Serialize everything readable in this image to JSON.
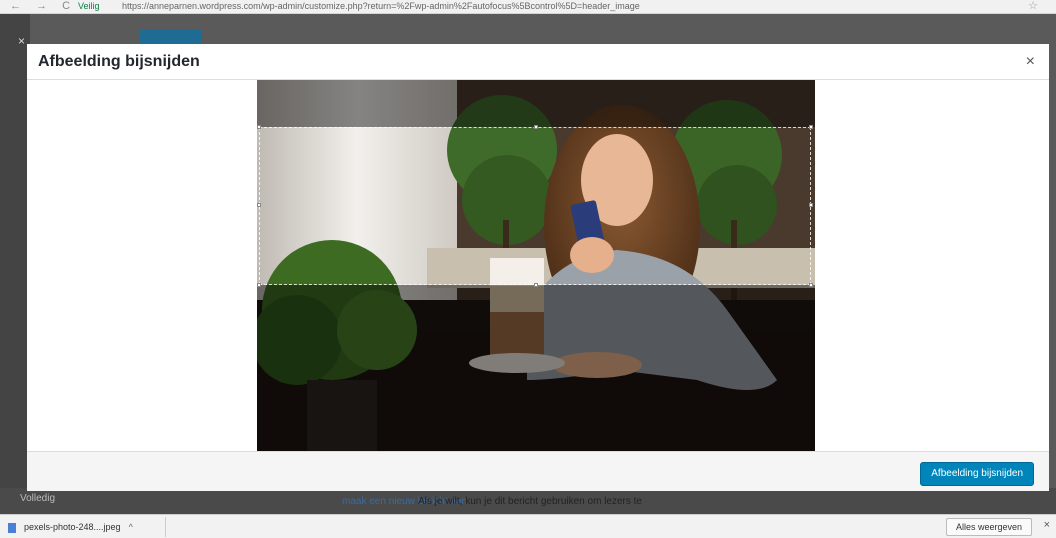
{
  "browser": {
    "nav_glyphs": "← → C",
    "secure_label": "Veilig",
    "url": "https://anneparnen.wordpress.com/wp-admin/customize.php?return=%2Fwp-admin%2Fautofocus%5Bcontrol%5D=header_image",
    "star_icon": "star-icon"
  },
  "background": {
    "sidebar_close": "×",
    "bottom_left": "Volledig",
    "bottom_link": "maak een nieuw bericht aan",
    "bottom_text": "Als je wilt, kun je dit bericht gebruiken om lezers te"
  },
  "modal": {
    "title": "Afbeelding bijsnijden",
    "close": "×",
    "crop_button": "Afbeelding bijsnijden"
  },
  "downloads": {
    "file_name": "pexels-photo-248....jpeg",
    "chevron": "^",
    "show_all": "Alles weergeven",
    "close": "×"
  },
  "colors": {
    "primary_button": "#0085ba",
    "secure_green": "#0b8043"
  }
}
